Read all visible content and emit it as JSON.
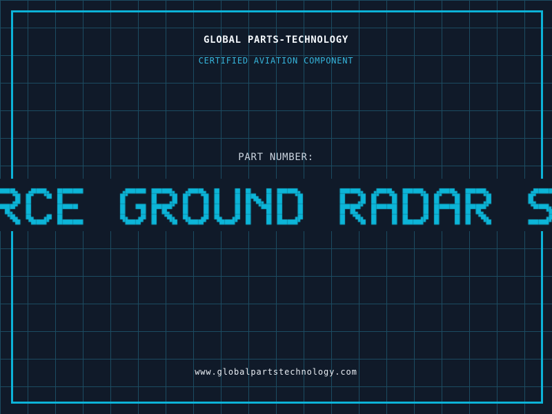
{
  "theme": {
    "bg": "#101a29",
    "grid_color": "#1c4c62",
    "frame_color": "#0cb3d8",
    "title_color": "#f2f6fa",
    "subtitle_color": "#35b5dc",
    "part_label_color": "#ccd5e0",
    "url_color": "#e8edf3",
    "marquee_color": "#0cb5d8"
  },
  "header": {
    "title": "GLOBAL PARTS-TECHNOLOGY",
    "subtitle": "CERTIFIED AVIATION COMPONENT"
  },
  "part_section": {
    "label": "PART NUMBER:"
  },
  "marquee": {
    "visible_text": "RCE GROUND RADAR S"
  },
  "footer": {
    "url": "www.globalpartstechnology.com"
  }
}
